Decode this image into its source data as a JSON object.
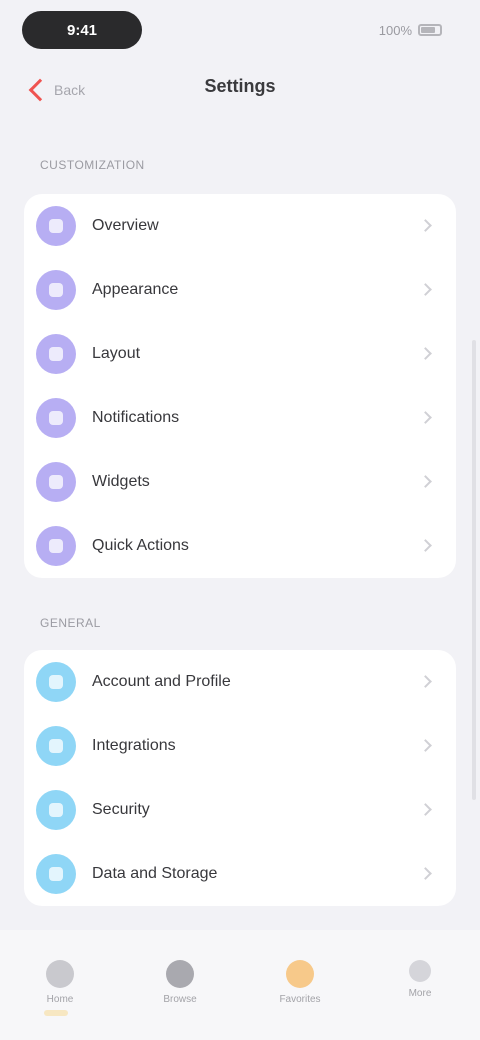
{
  "status_bar": {
    "time": "9:41",
    "right_text": "100%"
  },
  "header": {
    "back_label": "Back",
    "title": "Settings"
  },
  "sections": [
    {
      "title": "Customization",
      "items": [
        {
          "label": "Overview",
          "icon": "overview-icon",
          "color": "#b7aef3"
        },
        {
          "label": "Appearance",
          "icon": "appearance-icon",
          "color": "#b7aef3"
        },
        {
          "label": "Layout",
          "icon": "layout-icon",
          "color": "#b7aef3"
        },
        {
          "label": "Notifications",
          "icon": "notifications-icon",
          "color": "#b7aef3"
        },
        {
          "label": "Widgets",
          "icon": "widgets-icon",
          "color": "#b7aef3"
        },
        {
          "label": "Quick Actions",
          "icon": "quick-actions-icon",
          "color": "#b7aef3"
        }
      ]
    },
    {
      "title": "General",
      "items": [
        {
          "label": "Account and Profile",
          "icon": "account-icon",
          "color": "#8fd6f6"
        },
        {
          "label": "Integrations",
          "icon": "integrations-icon",
          "color": "#8fd6f6"
        },
        {
          "label": "Security",
          "icon": "security-icon",
          "color": "#8fd6f6"
        },
        {
          "label": "Data and Storage",
          "icon": "storage-icon",
          "color": "#8fd6f6"
        }
      ]
    }
  ],
  "tab_bar": {
    "tabs": [
      {
        "label": "Home",
        "icon": "home-icon"
      },
      {
        "label": "Browse",
        "icon": "grid-icon"
      },
      {
        "label": "Favorites",
        "icon": "star-icon"
      },
      {
        "label": "More",
        "icon": "more-icon"
      }
    ]
  }
}
